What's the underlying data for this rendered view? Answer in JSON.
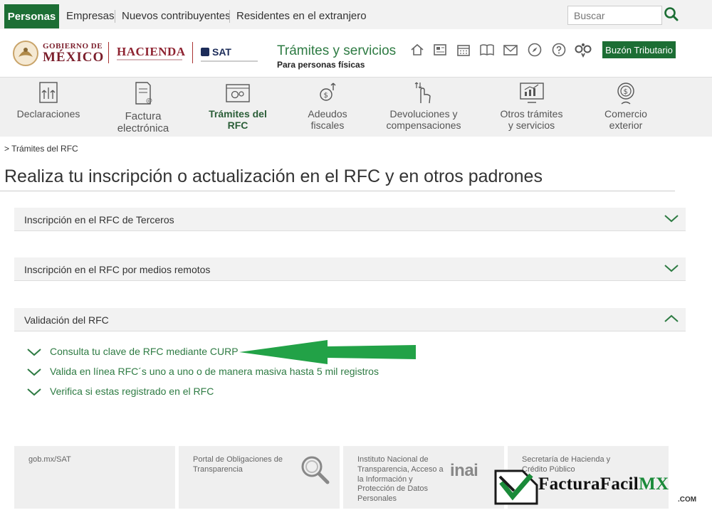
{
  "topbar": {
    "tabs": [
      "Personas",
      "Empresas",
      "Nuevos contribuyentes",
      "Residentes en el extranjero"
    ],
    "search_placeholder": "Buscar"
  },
  "header": {
    "gob_line1": "GOBIERNO DE",
    "gob_line2": "MÉXICO",
    "hacienda": "HACIENDA",
    "sat": "SAT",
    "title": "Trámites y servicios",
    "subtitle": "Para personas físicas",
    "buzon": "Buzón Tributario",
    "icons": [
      "home-icon",
      "news-icon",
      "calendar-icon",
      "book-icon",
      "mail-icon",
      "compass-icon",
      "help-icon",
      "accessibility-icon"
    ]
  },
  "nav": {
    "items": [
      {
        "l1": "Declaraciones",
        "l2": "",
        "icon": "declaraciones-icon"
      },
      {
        "l1": "Factura",
        "l2": "electrónica",
        "icon": "factura-icon"
      },
      {
        "l1": "Trámites del",
        "l2": "RFC",
        "icon": "tramites-rfc-icon"
      },
      {
        "l1": "Adeudos",
        "l2": "fiscales",
        "icon": "adeudos-icon"
      },
      {
        "l1": "Devoluciones y",
        "l2": "compensaciones",
        "icon": "devoluciones-icon"
      },
      {
        "l1": "Otros trámites",
        "l2": "y servicios",
        "icon": "otros-tramites-icon"
      },
      {
        "l1": "Comercio",
        "l2": "exterior",
        "icon": "comercio-exterior-icon"
      }
    ]
  },
  "breadcrumb": "> Trámites del RFC",
  "page_title": "Realiza tu inscripción o actualización en el RFC y en otros padrones",
  "accordion": [
    "Inscripción en el RFC de Terceros",
    "Inscripción en el RFC por medios remotos",
    "Validación del RFC"
  ],
  "sub_links": [
    "Consulta tu clave de RFC mediante CURP",
    "Valida en línea RFC´s uno a uno o de manera masiva hasta 5 mil registros",
    "Verifica si estas registrado en el RFC"
  ],
  "footer": {
    "col1": "gob.mx/SAT",
    "col2": "Portal de Obligaciones de Transparencia",
    "col3": "Instituto Nacional de Transparencia, Acceso a la Información y Protección de Datos Personales",
    "col3_logo": "inai",
    "col4": "Secretaría de Hacienda y Crédito Público"
  },
  "brand": {
    "name": "FacturaFacil",
    "suffix": "MX",
    "domain": ".COM"
  },
  "colors": {
    "green": "#1c6e34",
    "link_green": "#2e7b43",
    "arrow_green": "#22a247",
    "wine": "#8e2331"
  }
}
